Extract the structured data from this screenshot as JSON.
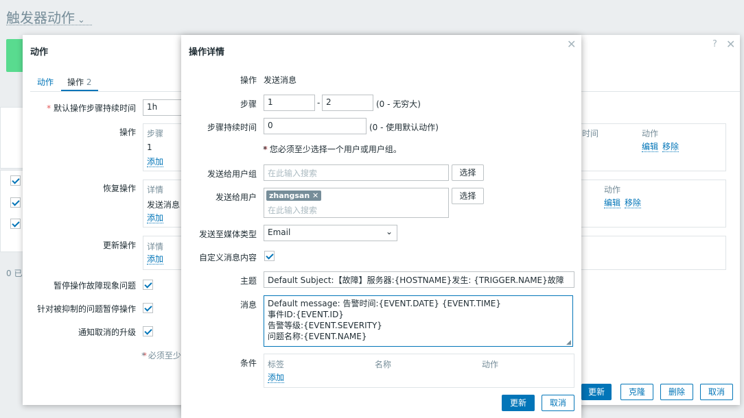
{
  "page": {
    "title": "触发器动作"
  },
  "action_dialog": {
    "title": "动作",
    "tabs": [
      {
        "label": "动作"
      },
      {
        "label": "操作",
        "count": "2"
      }
    ],
    "default_duration": {
      "label": "默认操作步骤持续时间",
      "value": "1h"
    },
    "operations": {
      "label": "操作",
      "col_steps": "步骤",
      "row_step": "1",
      "add": "添加",
      "col_time": "时间",
      "col_actions": "动作",
      "edit": "编辑",
      "remove": "移除"
    },
    "recovery": {
      "label": "恢复操作",
      "col_details": "详情",
      "row_details": "发送消息",
      "add": "添加",
      "col_actions": "动作",
      "edit": "编辑",
      "remove": "移除"
    },
    "update": {
      "label": "更新操作",
      "col_details": "详情",
      "add": "添加"
    },
    "pause_problem": {
      "label": "暂停操作故障现象问题"
    },
    "pause_suppressed": {
      "label": "针对被抑制的问题暂停操作"
    },
    "notify_cancel": {
      "label": "通知取消的升级"
    },
    "required_note": "* 必须至少",
    "buttons": {
      "update": "更新",
      "clone": "克隆",
      "delete": "删除",
      "cancel": "取消"
    },
    "bg_count": "0 已"
  },
  "operation_dialog": {
    "title": "操作详情",
    "operation": {
      "label": "操作",
      "value": "发送消息"
    },
    "steps": {
      "label": "步骤",
      "from": "1",
      "sep": "-",
      "to": "2",
      "hint": "(0 - 无穷大)"
    },
    "step_duration": {
      "label": "步骤持续时间",
      "value": "0",
      "hint": "(0 - 使用默认动作)"
    },
    "warning": "* 您必须至少选择一个用户或用户组。",
    "user_groups": {
      "label": "发送给用户组",
      "placeholder": "在此输入搜索",
      "select": "选择"
    },
    "users": {
      "label": "发送给用户",
      "tag": "zhangsan",
      "placeholder": "在此输入搜索",
      "select": "选择"
    },
    "media_type": {
      "label": "发送至媒体类型",
      "value": "Email"
    },
    "custom_message": {
      "label": "自定义消息内容"
    },
    "subject": {
      "label": "主题",
      "value": "Default Subject:【故障】服务器:{HOSTNAME}发生: {TRIGGER.NAME}故障"
    },
    "message": {
      "label": "消息",
      "lines": [
        "Default message: 告警时间:{EVENT.DATE} {EVENT.TIME}",
        "事件ID:{EVENT.ID}",
        "告警等级:{EVENT.SEVERITY}",
        "问题名称:{EVENT.NAME}"
      ]
    },
    "conditions": {
      "label": "条件",
      "col_label": "标签",
      "col_name": "名称",
      "col_action": "动作",
      "add": "添加"
    },
    "buttons": {
      "update": "更新",
      "cancel": "取消"
    }
  },
  "colors": {
    "accent": "#0275b8",
    "required": "#e45959",
    "success": "#59db8f"
  }
}
